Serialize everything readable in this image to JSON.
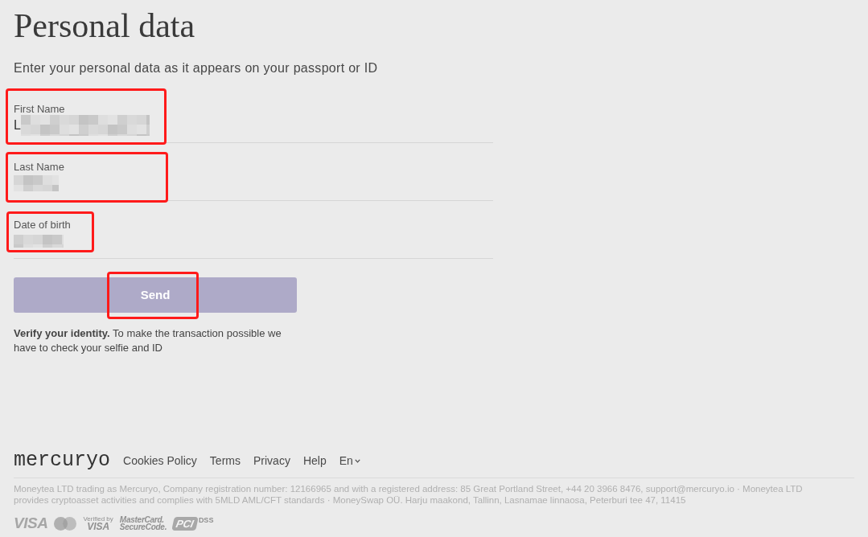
{
  "page": {
    "title": "Personal data",
    "subtitle": "Enter your personal data as it appears on your passport or ID"
  },
  "fields": [
    {
      "label": "First Name",
      "value": "L",
      "redacted": true,
      "highlighted": true
    },
    {
      "label": "Last Name",
      "redacted": true,
      "highlighted": true
    },
    {
      "label": "Date of birth",
      "redacted": true,
      "highlighted": true
    }
  ],
  "send_button": {
    "label": "Send",
    "disabled": true,
    "highlighted": true
  },
  "notice": "**Verify your identity.** To make the transaction possible we have to check your selfie and ID",
  "footer": {
    "logo": "mercuryo",
    "links": [
      "Cookies Policy",
      "Terms",
      "Privacy",
      "Help"
    ],
    "language": "En",
    "legal_text": "Moneytea LTD trading as Mercuryo, Company registration number: 12166965 and with a registered address: 85 Great Portland Street, +44 20 3966 8476, support@mercuryo.io · Moneytea LTD provides cryptoasset activities and complies with 5MLD AML/CFT standards · MoneySwap OÜ. Harju maakond, Tallinn, Lasnamae linnaosa, Peterburi tee 47, 11415",
    "payment_logos": [
      {
        "kind": "wordmark",
        "lines": [
          "VISA"
        ]
      },
      {
        "kind": "circles"
      },
      {
        "kind": "verified",
        "lines": [
          "Verified by",
          "VISA"
        ]
      },
      {
        "kind": "securecode",
        "lines": [
          "MasterCard.",
          "SecureCode."
        ]
      },
      {
        "kind": "pci",
        "lines": [
          "PCI",
          "DSS"
        ]
      }
    ]
  }
}
